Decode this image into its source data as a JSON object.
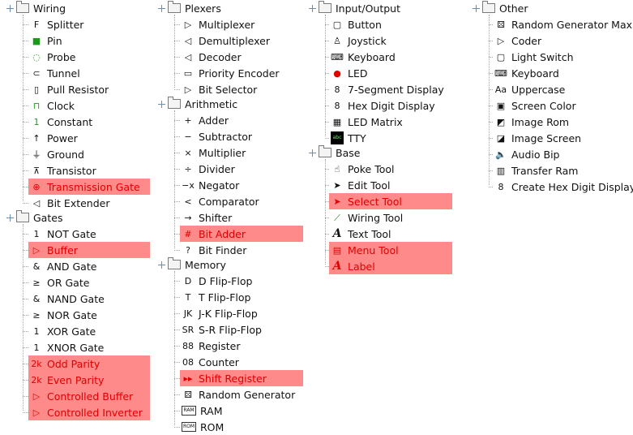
{
  "tree": {
    "wiring": {
      "title": "Wiring",
      "items": [
        {
          "label": "Splitter",
          "icon": "splitter-icon",
          "glyph": "F",
          "hl": false
        },
        {
          "label": "Pin",
          "icon": "pin-icon",
          "glyph": "■",
          "hl": false
        },
        {
          "label": "Probe",
          "icon": "probe-icon",
          "glyph": "◌",
          "hl": false
        },
        {
          "label": "Tunnel",
          "icon": "tunnel-icon",
          "glyph": "⊂",
          "hl": false
        },
        {
          "label": "Pull Resistor",
          "icon": "pull-resistor-icon",
          "glyph": "▯",
          "hl": false
        },
        {
          "label": "Clock",
          "icon": "clock-icon",
          "glyph": "⊓",
          "hl": false
        },
        {
          "label": "Constant",
          "icon": "constant-icon",
          "glyph": "1",
          "hl": false
        },
        {
          "label": "Power",
          "icon": "power-icon",
          "glyph": "↑",
          "hl": false
        },
        {
          "label": "Ground",
          "icon": "ground-icon",
          "glyph": "⏚",
          "hl": false
        },
        {
          "label": "Transistor",
          "icon": "transistor-icon",
          "glyph": "⊼",
          "hl": false
        },
        {
          "label": "Transmission Gate",
          "icon": "transmission-gate-icon",
          "glyph": "⊕",
          "hl": true
        },
        {
          "label": "Bit Extender",
          "icon": "bit-extender-icon",
          "glyph": "◁",
          "hl": false
        }
      ]
    },
    "gates": {
      "title": "Gates",
      "items": [
        {
          "label": "NOT Gate",
          "icon": "not-gate-icon",
          "glyph": "1",
          "hl": false
        },
        {
          "label": "Buffer",
          "icon": "buffer-icon",
          "glyph": "▷",
          "hl": true
        },
        {
          "label": "AND Gate",
          "icon": "and-gate-icon",
          "glyph": "&",
          "hl": false
        },
        {
          "label": "OR Gate",
          "icon": "or-gate-icon",
          "glyph": "≥",
          "hl": false
        },
        {
          "label": "NAND Gate",
          "icon": "nand-gate-icon",
          "glyph": "&",
          "hl": false
        },
        {
          "label": "NOR Gate",
          "icon": "nor-gate-icon",
          "glyph": "≥",
          "hl": false
        },
        {
          "label": "XOR Gate",
          "icon": "xor-gate-icon",
          "glyph": "1",
          "hl": false
        },
        {
          "label": "XNOR Gate",
          "icon": "xnor-gate-icon",
          "glyph": "1",
          "hl": false
        },
        {
          "label": "Odd Parity",
          "icon": "odd-parity-icon",
          "glyph": "2k",
          "hl": true
        },
        {
          "label": "Even Parity",
          "icon": "even-parity-icon",
          "glyph": "2k",
          "hl": true
        },
        {
          "label": "Controlled Buffer",
          "icon": "controlled-buffer-icon",
          "glyph": "▷",
          "hl": true
        },
        {
          "label": "Controlled Inverter",
          "icon": "controlled-inverter-icon",
          "glyph": "▷",
          "hl": true
        }
      ]
    },
    "plexers": {
      "title": "Plexers",
      "items": [
        {
          "label": "Multiplexer",
          "icon": "multiplexer-icon",
          "glyph": "▷",
          "hl": false
        },
        {
          "label": "Demultiplexer",
          "icon": "demultiplexer-icon",
          "glyph": "◁",
          "hl": false
        },
        {
          "label": "Decoder",
          "icon": "decoder-icon",
          "glyph": "◁",
          "hl": false
        },
        {
          "label": "Priority Encoder",
          "icon": "priority-encoder-icon",
          "glyph": "▭",
          "hl": false
        },
        {
          "label": "Bit Selector",
          "icon": "bit-selector-icon",
          "glyph": "▷",
          "hl": false
        }
      ]
    },
    "arithmetic": {
      "title": "Arithmetic",
      "items": [
        {
          "label": "Adder",
          "icon": "adder-icon",
          "glyph": "+",
          "hl": false
        },
        {
          "label": "Subtractor",
          "icon": "subtractor-icon",
          "glyph": "−",
          "hl": false
        },
        {
          "label": "Multiplier",
          "icon": "multiplier-icon",
          "glyph": "×",
          "hl": false
        },
        {
          "label": "Divider",
          "icon": "divider-icon",
          "glyph": "÷",
          "hl": false
        },
        {
          "label": "Negator",
          "icon": "negator-icon",
          "glyph": "−x",
          "hl": false
        },
        {
          "label": "Comparator",
          "icon": "comparator-icon",
          "glyph": "<",
          "hl": false
        },
        {
          "label": "Shifter",
          "icon": "shifter-icon",
          "glyph": "→",
          "hl": false
        },
        {
          "label": "Bit Adder",
          "icon": "bit-adder-icon",
          "glyph": "#",
          "hl": true
        },
        {
          "label": "Bit Finder",
          "icon": "bit-finder-icon",
          "glyph": "?",
          "hl": false
        }
      ]
    },
    "memory": {
      "title": "Memory",
      "items": [
        {
          "label": "D Flip-Flop",
          "icon": "d-flip-flop-icon",
          "glyph": "D",
          "hl": false
        },
        {
          "label": "T Flip-Flop",
          "icon": "t-flip-flop-icon",
          "glyph": "T",
          "hl": false
        },
        {
          "label": "J-K Flip-Flop",
          "icon": "jk-flip-flop-icon",
          "glyph": "JK",
          "hl": false
        },
        {
          "label": "S-R Flip-Flop",
          "icon": "sr-flip-flop-icon",
          "glyph": "SR",
          "hl": false
        },
        {
          "label": "Register",
          "icon": "register-icon",
          "glyph": "88",
          "hl": false
        },
        {
          "label": "Counter",
          "icon": "counter-icon",
          "glyph": "08",
          "hl": false
        },
        {
          "label": "Shift Register",
          "icon": "shift-register-icon",
          "glyph": "▸▸",
          "hl": true
        },
        {
          "label": "Random Generator",
          "icon": "random-generator-icon",
          "glyph": "⚄",
          "hl": false
        },
        {
          "label": "RAM",
          "icon": "ram-icon",
          "glyph": "RAM",
          "hl": false
        },
        {
          "label": "ROM",
          "icon": "rom-icon",
          "glyph": "ROM",
          "hl": false
        }
      ]
    },
    "io": {
      "title": "Input/Output",
      "items": [
        {
          "label": "Button",
          "icon": "button-icon",
          "glyph": "▢",
          "hl": false
        },
        {
          "label": "Joystick",
          "icon": "joystick-icon",
          "glyph": "♙",
          "hl": false
        },
        {
          "label": "Keyboard",
          "icon": "keyboard-icon",
          "glyph": "⌨",
          "hl": false
        },
        {
          "label": "LED",
          "icon": "led-icon",
          "glyph": "●",
          "hl": false
        },
        {
          "label": "7-Segment Display",
          "icon": "seven-segment-icon",
          "glyph": "8",
          "hl": false
        },
        {
          "label": "Hex Digit Display",
          "icon": "hex-digit-display-icon",
          "glyph": "8",
          "hl": false
        },
        {
          "label": "LED Matrix",
          "icon": "led-matrix-icon",
          "glyph": "▦",
          "hl": false
        },
        {
          "label": "TTY",
          "icon": "tty-icon",
          "glyph": "abc",
          "hl": false
        }
      ]
    },
    "base": {
      "title": "Base",
      "items": [
        {
          "label": "Poke Tool",
          "icon": "poke-tool-icon",
          "glyph": "☝",
          "hl": false
        },
        {
          "label": "Edit Tool",
          "icon": "edit-tool-icon",
          "glyph": "➤",
          "hl": false
        },
        {
          "label": "Select Tool",
          "icon": "select-tool-icon",
          "glyph": "➤",
          "hl": true
        },
        {
          "label": "Wiring Tool",
          "icon": "wiring-tool-icon",
          "glyph": "⟋",
          "hl": false
        },
        {
          "label": "Text Tool",
          "icon": "text-tool-icon",
          "glyph": "A",
          "hl": false
        },
        {
          "label": "Menu Tool",
          "icon": "menu-tool-icon",
          "glyph": "▤",
          "hl": true
        },
        {
          "label": "Label",
          "icon": "label-icon",
          "glyph": "A",
          "hl": true
        }
      ]
    },
    "other": {
      "title": "Other",
      "items": [
        {
          "label": "Random Generator Max",
          "icon": "random-generator-max-icon",
          "glyph": "⚄",
          "hl": false
        },
        {
          "label": "Coder",
          "icon": "coder-icon",
          "glyph": "▷",
          "hl": false
        },
        {
          "label": "Light Switch",
          "icon": "light-switch-icon",
          "glyph": "▢",
          "hl": false
        },
        {
          "label": "Keyboard",
          "icon": "keyboard-icon",
          "glyph": "⌨",
          "hl": false
        },
        {
          "label": "Uppercase",
          "icon": "uppercase-icon",
          "glyph": "Aa",
          "hl": false
        },
        {
          "label": "Screen Color",
          "icon": "screen-color-icon",
          "glyph": "▣",
          "hl": false
        },
        {
          "label": "Image Rom",
          "icon": "image-rom-icon",
          "glyph": "◩",
          "hl": false
        },
        {
          "label": "Image Screen",
          "icon": "image-screen-icon",
          "glyph": "◪",
          "hl": false
        },
        {
          "label": "Audio Bip",
          "icon": "audio-bip-icon",
          "glyph": "🔈",
          "hl": false
        },
        {
          "label": "Transfer Ram",
          "icon": "transfer-ram-icon",
          "glyph": "▥",
          "hl": false
        },
        {
          "label": "Create Hex Digit Display",
          "icon": "create-hex-digit-display-icon",
          "glyph": "8",
          "hl": false
        }
      ]
    }
  },
  "colors": {
    "highlight_bg": "#ff8a8a",
    "highlight_text": "#e00000",
    "tree_line": "#a0a0a0"
  }
}
